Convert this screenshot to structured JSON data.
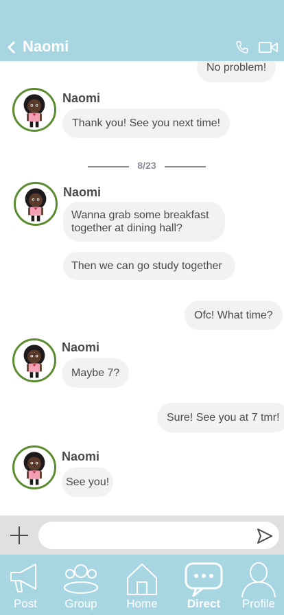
{
  "header": {
    "title": "Naomi"
  },
  "chat": {
    "messages": [
      {
        "type": "outgoing",
        "text": "No problem!"
      },
      {
        "type": "incoming",
        "name": "Naomi",
        "texts": [
          "Thank you! See you next time!"
        ]
      },
      {
        "type": "date",
        "text": "8/23"
      },
      {
        "type": "incoming",
        "name": "Naomi",
        "texts": [
          "Wanna grab some breakfast together at dining hall?",
          "Then we can go study together"
        ]
      },
      {
        "type": "outgoing",
        "text": "Ofc! What time?"
      },
      {
        "type": "incoming",
        "name": "Naomi",
        "texts": [
          "Maybe 7?"
        ]
      },
      {
        "type": "outgoing",
        "text": "Sure! See you at 7 tmr!"
      },
      {
        "type": "incoming",
        "name": "Naomi",
        "texts": [
          "See you!"
        ]
      }
    ]
  },
  "composer": {
    "value": "",
    "placeholder": ""
  },
  "tabbar": {
    "tabs": [
      {
        "label": "Post",
        "icon": "megaphone-icon"
      },
      {
        "label": "Group",
        "icon": "group-icon"
      },
      {
        "label": "Home",
        "icon": "house-icon"
      },
      {
        "label": "Direct",
        "icon": "chat-bubble-icon",
        "active": true
      },
      {
        "label": "Profile",
        "icon": "person-icon"
      }
    ]
  },
  "colors": {
    "header": "#a8d5e2",
    "tabbar": "#a8d5e2",
    "bubble": "#f2f2f2",
    "avatar_ring": "#5a8c2f"
  }
}
